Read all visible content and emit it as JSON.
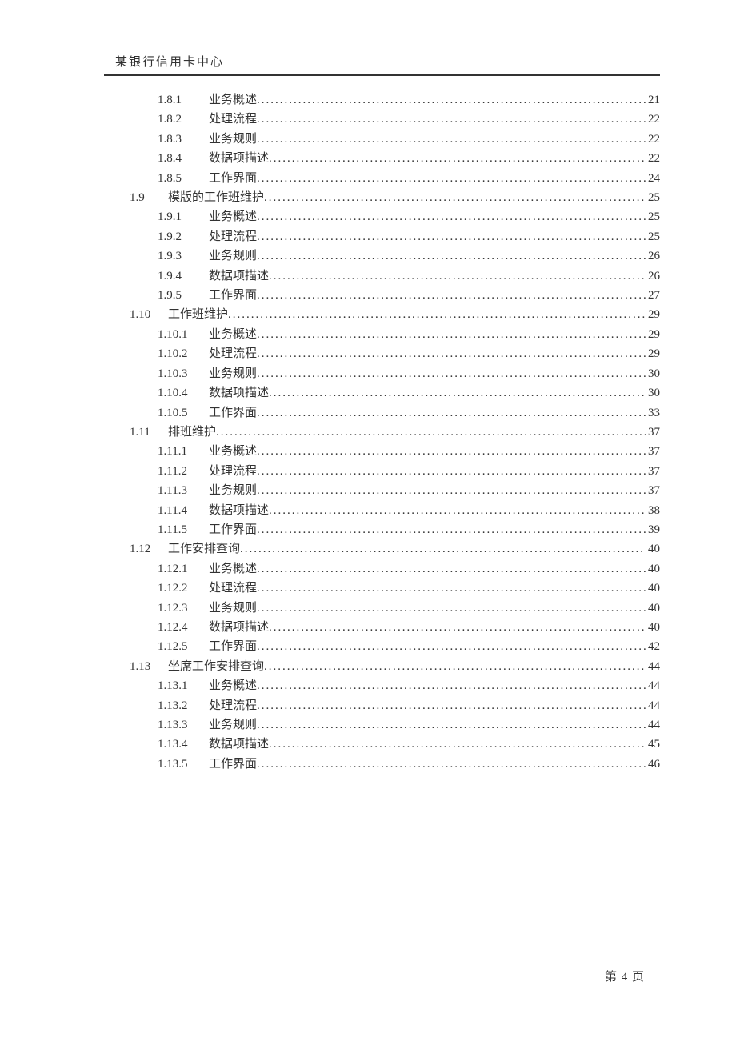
{
  "header": {
    "title": "某银行信用卡中心"
  },
  "toc": [
    {
      "level": 3,
      "num": "1.8.1",
      "title": "业务概述",
      "page": "21"
    },
    {
      "level": 3,
      "num": "1.8.2",
      "title": "处理流程",
      "page": "22"
    },
    {
      "level": 3,
      "num": "1.8.3",
      "title": "业务规则",
      "page": "22"
    },
    {
      "level": 3,
      "num": "1.8.4",
      "title": "数据项描述",
      "page": "22"
    },
    {
      "level": 3,
      "num": "1.8.5",
      "title": "工作界面",
      "page": "24"
    },
    {
      "level": 2,
      "num": "1.9",
      "title": "模版的工作班维护",
      "page": "25"
    },
    {
      "level": 3,
      "num": "1.9.1",
      "title": "业务概述",
      "page": "25"
    },
    {
      "level": 3,
      "num": "1.9.2",
      "title": "处理流程",
      "page": "25"
    },
    {
      "level": 3,
      "num": "1.9.3",
      "title": "业务规则",
      "page": "26"
    },
    {
      "level": 3,
      "num": "1.9.4",
      "title": "数据项描述",
      "page": "26"
    },
    {
      "level": 3,
      "num": "1.9.5",
      "title": "工作界面",
      "page": "27"
    },
    {
      "level": 2,
      "num": "1.10",
      "title": "工作班维护",
      "page": "29"
    },
    {
      "level": 3,
      "num": "1.10.1",
      "title": "业务概述",
      "page": "29"
    },
    {
      "level": 3,
      "num": "1.10.2",
      "title": "处理流程",
      "page": "29"
    },
    {
      "level": 3,
      "num": "1.10.3",
      "title": "业务规则",
      "page": "30"
    },
    {
      "level": 3,
      "num": "1.10.4",
      "title": "数据项描述",
      "page": "30"
    },
    {
      "level": 3,
      "num": "1.10.5",
      "title": "工作界面",
      "page": "33"
    },
    {
      "level": 2,
      "num": "1.11",
      "title": "排班维护",
      "page": "37"
    },
    {
      "level": 3,
      "num": "1.11.1",
      "title": "业务概述",
      "page": "37"
    },
    {
      "level": 3,
      "num": "1.11.2",
      "title": "处理流程",
      "page": "37"
    },
    {
      "level": 3,
      "num": "1.11.3",
      "title": "业务规则",
      "page": "37"
    },
    {
      "level": 3,
      "num": "1.11.4",
      "title": "数据项描述",
      "page": "38"
    },
    {
      "level": 3,
      "num": "1.11.5",
      "title": "工作界面",
      "page": "39"
    },
    {
      "level": 2,
      "num": "1.12",
      "title": "工作安排查询",
      "page": "40"
    },
    {
      "level": 3,
      "num": "1.12.1",
      "title": "业务概述",
      "page": "40"
    },
    {
      "level": 3,
      "num": "1.12.2",
      "title": "处理流程",
      "page": "40"
    },
    {
      "level": 3,
      "num": "1.12.3",
      "title": "业务规则",
      "page": "40"
    },
    {
      "level": 3,
      "num": "1.12.4",
      "title": "数据项描述",
      "page": "40"
    },
    {
      "level": 3,
      "num": "1.12.5",
      "title": "工作界面",
      "page": "42"
    },
    {
      "level": 2,
      "num": "1.13",
      "title": "坐席工作安排查询",
      "page": "44"
    },
    {
      "level": 3,
      "num": "1.13.1",
      "title": "业务概述",
      "page": "44"
    },
    {
      "level": 3,
      "num": "1.13.2",
      "title": "处理流程",
      "page": "44"
    },
    {
      "level": 3,
      "num": "1.13.3",
      "title": "业务规则",
      "page": "44"
    },
    {
      "level": 3,
      "num": "1.13.4",
      "title": "数据项描述",
      "page": "45"
    },
    {
      "level": 3,
      "num": "1.13.5",
      "title": "工作界面",
      "page": "46"
    }
  ],
  "footer": {
    "page_label": "第 4 页"
  }
}
